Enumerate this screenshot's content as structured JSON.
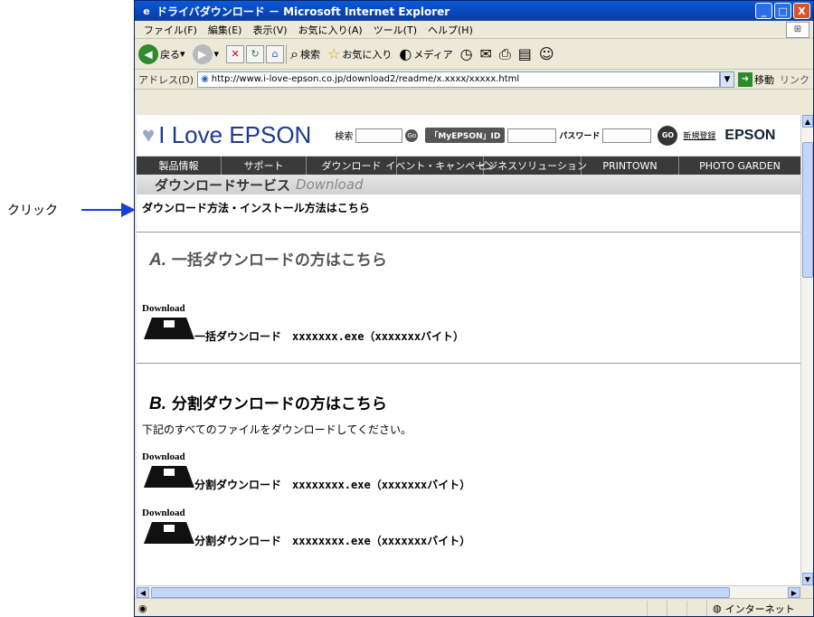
{
  "callout": {
    "label": "クリック"
  },
  "window": {
    "title": "ドライバダウンロード － Microsoft Internet Explorer",
    "controls": {
      "minimize": "_",
      "maximize": "□",
      "close": "X"
    }
  },
  "menubar": {
    "items": [
      "ファイル(F)",
      "編集(E)",
      "表示(V)",
      "お気に入り(A)",
      "ツール(T)",
      "ヘルプ(H)"
    ]
  },
  "toolbar": {
    "back_label": "戻る",
    "search_label": "検索",
    "favorites_label": "お気に入り",
    "media_label": "メディア"
  },
  "addressbar": {
    "label": "アドレス(D)",
    "url": "http://www.i-love-epson.co.jp/download2/readme/x.xxxx/xxxxx.html",
    "go_label": "移動",
    "links_label": "リンク"
  },
  "site": {
    "logo_text": "I Love EPSON",
    "search_label": "検索",
    "search_go": "Go",
    "myepson_label": "「MyEPSON」ID",
    "password_label": "パスワード",
    "login_go": "GO",
    "register_label": "新規登録",
    "brand": "EPSON",
    "nav": [
      "製品情報",
      "サポート",
      "ダウンロード",
      "イベント・キャンペーン",
      "ビジネスソリューション",
      "PRINTOWN",
      "PHOTO GARDEN"
    ]
  },
  "content": {
    "section_title_jp": "ダウンロードサービス",
    "section_title_en": "Download",
    "method_link": "ダウンロード方法・インストール方法はこちら",
    "section_a": {
      "letter": "A.",
      "title": "一括ダウンロードの方はこちら"
    },
    "section_b": {
      "letter": "B.",
      "title": "分割ダウンロードの方はこちら"
    },
    "instruction": "下記のすべてのファイルをダウンロードしてください。",
    "download_badge": "Download",
    "bulk_item": "一括ダウンロード　xxxxxxx.exe（xxxxxxxバイト）",
    "split_items": [
      "分割ダウンロード　xxxxxxxx.exe（xxxxxxxバイト）",
      "分割ダウンロード　xxxxxxxx.exe（xxxxxxxバイト）"
    ]
  },
  "statusbar": {
    "zone": "インターネット"
  }
}
